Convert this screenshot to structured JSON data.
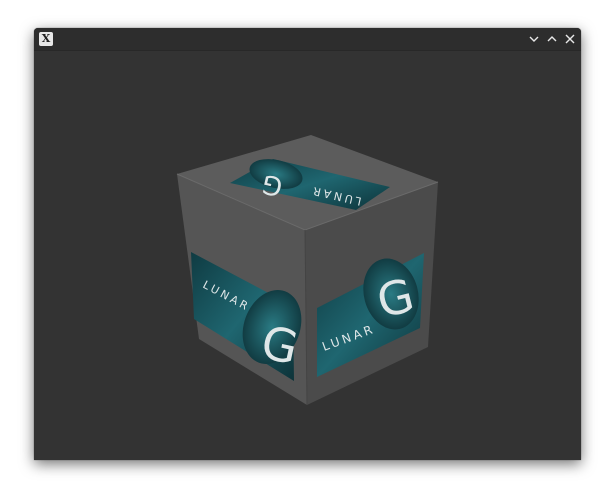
{
  "window": {
    "title": "",
    "app_icon": "x-window-icon",
    "controls": {
      "minimize_icon": "chevron-down-icon",
      "maximize_icon": "chevron-up-icon",
      "close_icon": "close-icon"
    }
  },
  "scene": {
    "logo_word": "LUNAR",
    "logo_mark": "G",
    "background_color": "#333333",
    "cube_color": "#5a5a5a",
    "logo_panel_color": "#1b5a62"
  }
}
